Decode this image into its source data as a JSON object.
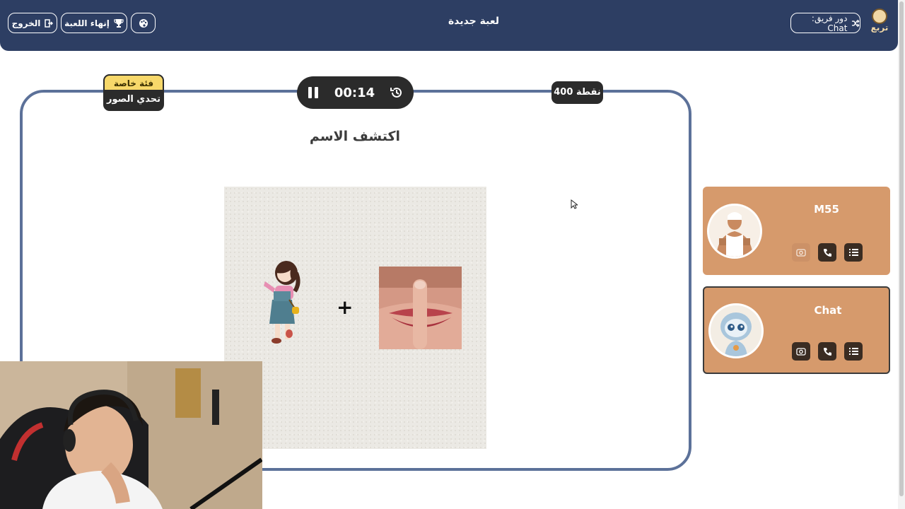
{
  "header": {
    "title": "لعبة جديدة",
    "exit_label": "الخروج",
    "end_game_label": "إنهاء اللعبة",
    "turn_label": "دور فريق: Chat",
    "logo_text": "تربع",
    "palette_icon": "palette-icon",
    "exit_icon": "exit-icon",
    "trophy_icon": "trophy-icon",
    "shuffle_icon": "shuffle-icon"
  },
  "board": {
    "category_top": "فئة خاصة",
    "category_name": "تحدي الصور",
    "timer": "00:14",
    "points": "400 نقطة",
    "question_title": "اكتشف الاسم",
    "plus_symbol": "+"
  },
  "teams": [
    {
      "name": "M55",
      "avatar": "muscle-man-avatar"
    },
    {
      "name": "Chat",
      "avatar": "robot-avatar"
    }
  ],
  "colors": {
    "header_bg": "#2d3e63",
    "board_border": "#5c7199",
    "card_bg": "#d69a6c",
    "badge_yellow": "#f7d86a",
    "dark": "#2b2b2b"
  }
}
